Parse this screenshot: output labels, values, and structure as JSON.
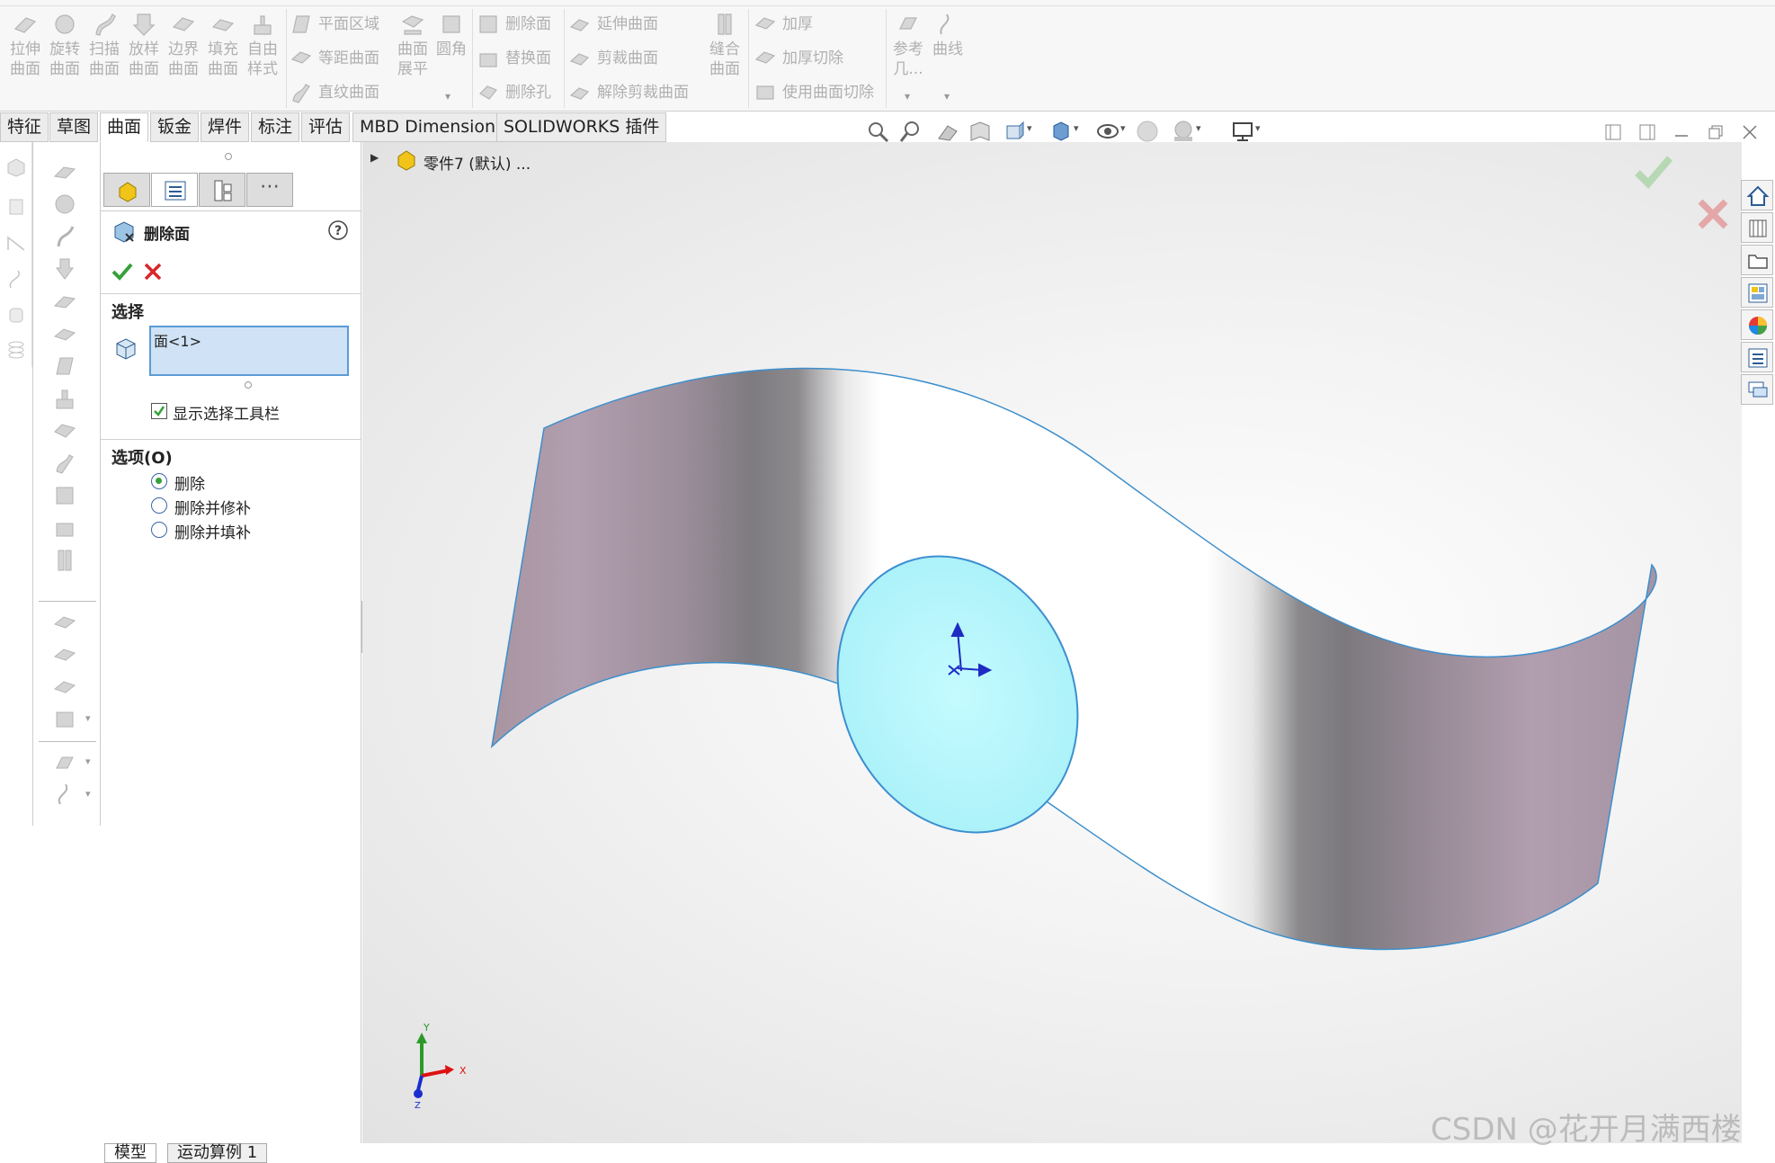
{
  "ribbon": {
    "big_buttons": [
      {
        "label": "拉伸\n曲面",
        "icon": "extruded-surface-icon"
      },
      {
        "label": "旋转\n曲面",
        "icon": "revolved-surface-icon"
      },
      {
        "label": "扫描\n曲面",
        "icon": "swept-surface-icon"
      },
      {
        "label": "放样\n曲面",
        "icon": "lofted-surface-icon"
      },
      {
        "label": "边界\n曲面",
        "icon": "boundary-surface-icon"
      },
      {
        "label": "填充\n曲面",
        "icon": "filled-surface-icon"
      },
      {
        "label": "自由\n样式",
        "icon": "freeform-icon"
      }
    ],
    "group2_small": [
      "平面区域",
      "等距曲面",
      "直纹曲面"
    ],
    "group2_big": [
      {
        "label": "曲面\n展平",
        "icon": "surface-flatten-icon"
      },
      {
        "label": "圆角",
        "icon": "fillet-icon"
      }
    ],
    "group3_small": [
      "删除面",
      "替换面",
      "删除孔"
    ],
    "group4_small": [
      "延伸曲面",
      "剪裁曲面",
      "解除剪裁曲面"
    ],
    "group5_big": {
      "label": "缝合\n曲面",
      "icon": "knit-surface-icon"
    },
    "group6_small": [
      "加厚",
      "加厚切除",
      "使用曲面切除"
    ],
    "group7_big": [
      {
        "label": "参考\n几...",
        "icon": "reference-geometry-icon"
      },
      {
        "label": "曲线",
        "icon": "curves-icon"
      }
    ]
  },
  "tabs": [
    {
      "label": "特征"
    },
    {
      "label": "草图"
    },
    {
      "label": "曲面",
      "active": true
    },
    {
      "label": "钣金"
    },
    {
      "label": "焊件"
    },
    {
      "label": "标注"
    },
    {
      "label": "评估"
    },
    {
      "label": "MBD Dimensions"
    },
    {
      "label": "SOLIDWORKS 插件"
    }
  ],
  "tree": {
    "part_name": "零件7 (默认) ..."
  },
  "panel": {
    "title": "删除面",
    "help_icon": "help-icon",
    "ok_icon": "checkmark-icon",
    "cancel_icon": "cancel-x-icon",
    "selection": {
      "header": "选择",
      "value": "面<1>",
      "checkbox_label": "显示选择工具栏",
      "checkbox_checked": true
    },
    "options": {
      "header": "选项(O)",
      "items": [
        {
          "label": "删除",
          "selected": true
        },
        {
          "label": "删除并修补",
          "selected": false
        },
        {
          "label": "删除并填补",
          "selected": false
        }
      ]
    }
  },
  "viewport": {
    "triad": {
      "x": "X",
      "y": "Y",
      "z": "Z"
    },
    "watermark": "CSDN @花开月满西楼"
  },
  "bottom_tabs": [
    {
      "label": "模型",
      "active": true
    },
    {
      "label": "运动算例 1"
    }
  ],
  "colors": {
    "selection_face": "#b6f6fb",
    "selection_edge": "#3c8fd0",
    "surface_mauve": "#a593a7",
    "ok_green": "#35a13a",
    "cancel_red": "#d9262a"
  }
}
